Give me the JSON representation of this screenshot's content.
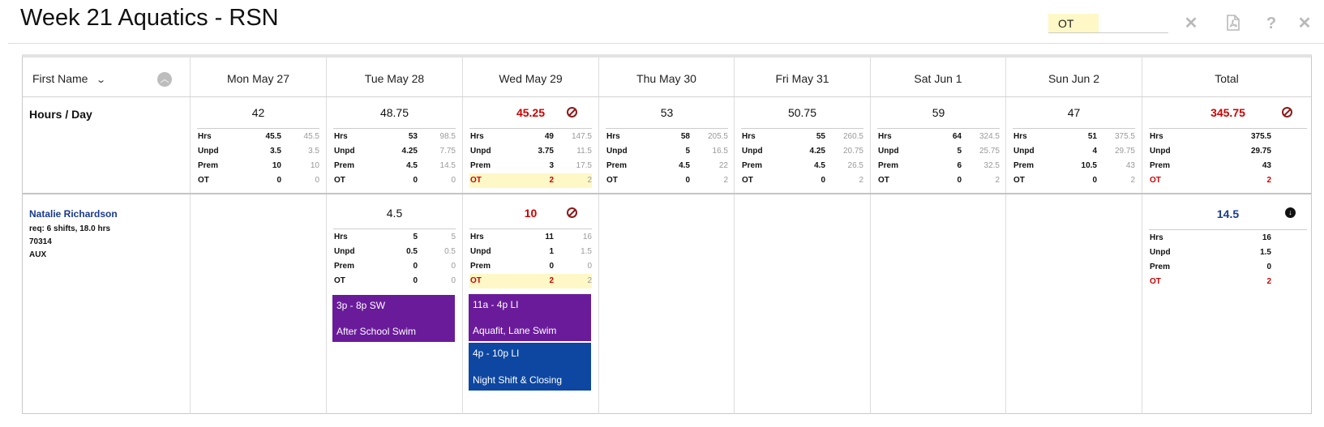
{
  "title": "Week 21 Aquatics - RSN",
  "filter_value": "OT",
  "toolbar": {
    "clear_icon": "x-icon",
    "pdf_icon": "pdf-icon",
    "help": "?",
    "close": "close-icon"
  },
  "sort": {
    "label": "First Name"
  },
  "days": [
    "Mon May 27",
    "Tue May 28",
    "Wed May 29",
    "Thu May 30",
    "Fri May 31",
    "Sat Jun 1",
    "Sun Jun 2",
    "Total"
  ],
  "hours_label": "Hours / Day",
  "labels": {
    "hrs": "Hrs",
    "unpd": "Unpd",
    "prem": "Prem",
    "ot": "OT"
  },
  "summary": [
    {
      "main": "42",
      "hrs": [
        "45.5",
        "45.5"
      ],
      "unpd": [
        "3.5",
        "3.5"
      ],
      "prem": [
        "10",
        "10"
      ],
      "ot": [
        "0",
        "0"
      ]
    },
    {
      "main": "48.75",
      "hrs": [
        "53",
        "98.5"
      ],
      "unpd": [
        "4.25",
        "7.75"
      ],
      "prem": [
        "4.5",
        "14.5"
      ],
      "ot": [
        "0",
        "0"
      ]
    },
    {
      "main": "45.25",
      "hrs": [
        "49",
        "147.5"
      ],
      "unpd": [
        "3.75",
        "11.5"
      ],
      "prem": [
        "3",
        "17.5"
      ],
      "ot": [
        "2",
        "2"
      ],
      "warn": true
    },
    {
      "main": "53",
      "hrs": [
        "58",
        "205.5"
      ],
      "unpd": [
        "5",
        "16.5"
      ],
      "prem": [
        "4.5",
        "22"
      ],
      "ot": [
        "0",
        "2"
      ]
    },
    {
      "main": "50.75",
      "hrs": [
        "55",
        "260.5"
      ],
      "unpd": [
        "4.25",
        "20.75"
      ],
      "prem": [
        "4.5",
        "26.5"
      ],
      "ot": [
        "0",
        "2"
      ]
    },
    {
      "main": "59",
      "hrs": [
        "64",
        "324.5"
      ],
      "unpd": [
        "5",
        "25.75"
      ],
      "prem": [
        "6",
        "32.5"
      ],
      "ot": [
        "0",
        "2"
      ]
    },
    {
      "main": "47",
      "hrs": [
        "51",
        "375.5"
      ],
      "unpd": [
        "4",
        "29.75"
      ],
      "prem": [
        "10.5",
        "43"
      ],
      "ot": [
        "0",
        "2"
      ]
    },
    {
      "main": "345.75",
      "hrs": [
        "375.5"
      ],
      "unpd": [
        "29.75"
      ],
      "prem": [
        "43"
      ],
      "ot": [
        "2"
      ],
      "warn": true
    }
  ],
  "employee": {
    "name": "Natalie Richardson",
    "req": "req: 6 shifts, 18.0 hrs",
    "id": "70314",
    "role": "AUX",
    "tue": {
      "main": "4.5",
      "hrs": [
        "5",
        "5"
      ],
      "unpd": [
        "0.5",
        "0.5"
      ],
      "prem": [
        "0",
        "0"
      ],
      "ot": [
        "0",
        "0"
      ]
    },
    "wed": {
      "main": "10",
      "hrs": [
        "11",
        "16"
      ],
      "unpd": [
        "1",
        "1.5"
      ],
      "prem": [
        "0",
        "0"
      ],
      "ot": [
        "2",
        "2"
      ]
    },
    "total": {
      "main": "14.5",
      "hrs": [
        "16"
      ],
      "unpd": [
        "1.5"
      ],
      "prem": [
        "0"
      ],
      "ot": [
        "2"
      ]
    },
    "shifts": [
      {
        "time": "3p - 8p SW",
        "desc": "After School Swim",
        "color": "#6a1b9a"
      },
      {
        "time": "11a - 4p LI",
        "desc": "Aquafit, Lane Swim",
        "color": "#6a1b9a"
      },
      {
        "time": "4p - 10p LI",
        "desc": "Night Shift & Closing",
        "color": "#0d47a1"
      }
    ]
  }
}
